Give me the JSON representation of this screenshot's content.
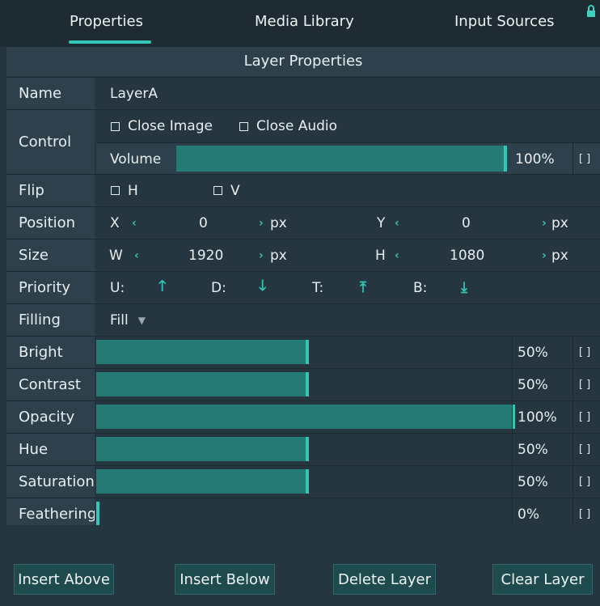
{
  "tabs": [
    {
      "label": "Properties"
    },
    {
      "label": "Media Library"
    },
    {
      "label": "Input Sources"
    }
  ],
  "section_title": "Layer Properties",
  "name": {
    "label": "Name",
    "value": "LayerA"
  },
  "control": {
    "label": "Control",
    "close_image": "Close Image",
    "close_audio": "Close Audio",
    "volume_label": "Volume",
    "volume_value": 100,
    "volume_text": "100%"
  },
  "flip": {
    "label": "Flip",
    "h": "H",
    "v": "V"
  },
  "position": {
    "label": "Position",
    "x_label": "X",
    "x_value": "0",
    "y_label": "Y",
    "y_value": "0",
    "unit": "px"
  },
  "size": {
    "label": "Size",
    "w_label": "W",
    "w_value": "1920",
    "h_label": "H",
    "h_value": "1080",
    "unit": "px"
  },
  "priority": {
    "label": "Priority",
    "u": "U:",
    "d": "D:",
    "t": "T:",
    "b": "B:"
  },
  "filling": {
    "label": "Filling",
    "value": "Fill"
  },
  "adjustments": [
    {
      "label": "Bright",
      "value": 50,
      "text": "50%"
    },
    {
      "label": "Contrast",
      "value": 50,
      "text": "50%"
    },
    {
      "label": "Opacity",
      "value": 100,
      "text": "100%"
    },
    {
      "label": "Hue",
      "value": 50,
      "text": "50%"
    },
    {
      "label": "Saturation",
      "value": 50,
      "text": "50%"
    },
    {
      "label": "Feathering",
      "value": 0,
      "text": "0%"
    }
  ],
  "buttons": {
    "insert_above": "Insert Above",
    "insert_below": "Insert Below",
    "delete_layer": "Delete Layer",
    "clear_layer": "Clear Layer"
  },
  "colors": {
    "accent": "#31c6b6",
    "fill": "#257a73",
    "panel": "#263640",
    "label_bg": "#2e404b"
  }
}
